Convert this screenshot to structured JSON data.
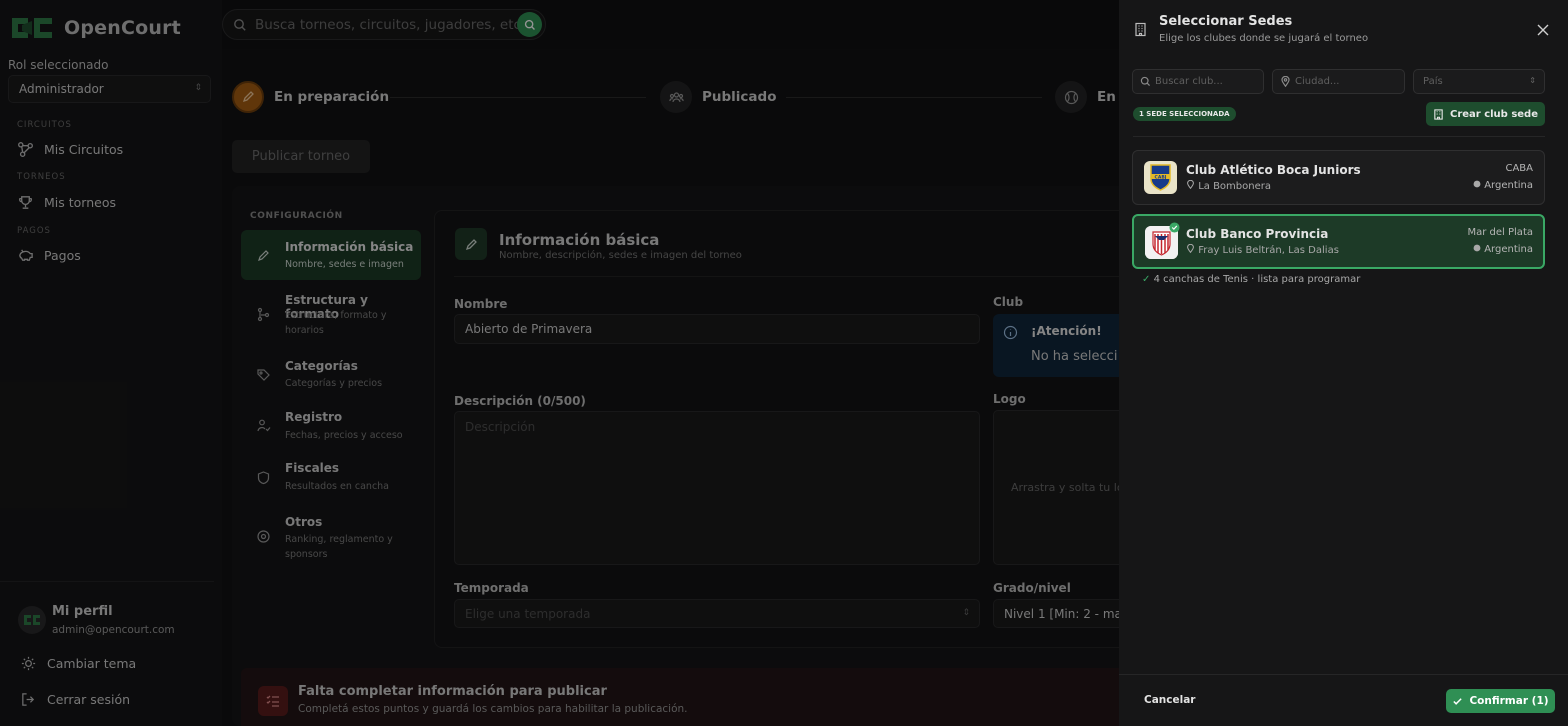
{
  "app": {
    "name": "OpenCourt"
  },
  "search": {
    "placeholder": "Busca torneos, circuitos, jugadores, etc."
  },
  "sidebar": {
    "role_label": "Rol seleccionado",
    "role_value": "Administrador",
    "sections": {
      "circuits": "CIRCUITOS",
      "tournaments": "TORNEOS",
      "payments": "PAGOS"
    },
    "items": {
      "circuits": "Mis Circuitos",
      "tournaments": "Mis torneos",
      "payments": "Pagos"
    },
    "profile": {
      "name": "Mi perfil",
      "email": "admin@opencourt.com"
    },
    "theme": "Cambiar tema",
    "logout": "Cerrar sesión"
  },
  "steps": [
    {
      "label": "En preparación",
      "status": "active"
    },
    {
      "label": "Publicado",
      "status": "pending"
    },
    {
      "label": "En j",
      "status": "pending"
    }
  ],
  "publish_button": "Publicar torneo",
  "config": {
    "title": "CONFIGURACIÓN",
    "items": [
      {
        "title": "Información básica",
        "sub": "Nombre, sedes e imagen"
      },
      {
        "title": "Estructura y formato",
        "sub": "Estructura, formato y horarios"
      },
      {
        "title": "Categorías",
        "sub": "Categorías y precios"
      },
      {
        "title": "Registro",
        "sub": "Fechas, precios y acceso"
      },
      {
        "title": "Fiscales",
        "sub": "Resultados en cancha"
      },
      {
        "title": "Otros",
        "sub": "Ranking, reglamento y sponsors"
      }
    ]
  },
  "form": {
    "title": "Información básica",
    "subtitle": "Nombre, descripción, sedes e imagen del torneo",
    "name_label": "Nombre",
    "name_value": "Abierto de Primavera",
    "club_label": "Club",
    "alert_title": "¡Atención!",
    "alert_message": "No ha selecci",
    "description_label": "Descripción (0/500)",
    "description_placeholder": "Descripción",
    "logo_label": "Logo",
    "logo_hint": "Arrastra y solta tu lo",
    "season_label": "Temporada",
    "season_placeholder": "Elige una temporada",
    "grade_label": "Grado/nivel",
    "grade_value": "Nivel 1 [Min: 2 - max"
  },
  "warning": {
    "title": "Falta completar información para publicar",
    "subtitle": "Completá estos puntos y guardá los cambios para habilitar la publicación."
  },
  "drawer": {
    "title": "Seleccionar Sedes",
    "subtitle": "Elige los clubes donde se jugará el torneo",
    "filters": {
      "club_placeholder": "Buscar club...",
      "city_placeholder": "Ciudad...",
      "country_placeholder": "País"
    },
    "selected_badge": "1 SEDE SELECCIONADA",
    "create_button": "Crear club sede",
    "clubs": [
      {
        "name": "Club Atlético Boca Juniors",
        "address": "La Bombonera",
        "city": "CABA",
        "country": "Argentina",
        "selected": false
      },
      {
        "name": "Club Banco Provincia",
        "address": "Fray Luis Beltrán, Las Dalias",
        "city": "Mar del Plata",
        "country": "Argentina",
        "selected": true
      }
    ],
    "ready_text": "4 canchas de Tenis · lista para programar",
    "cancel": "Cancelar",
    "confirm": "Confirmar (1)"
  },
  "colors": {
    "accent": "#2f8f54",
    "active_step": "#a65e12",
    "selected_club_border": "#3aa865"
  }
}
